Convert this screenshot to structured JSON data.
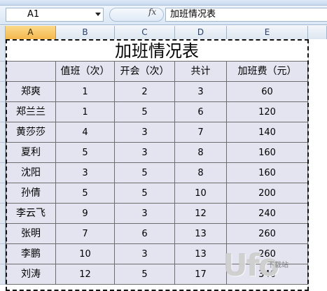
{
  "formula_bar": {
    "name_box": "A1",
    "fx_label": "fx",
    "formula_value": "加班情况表"
  },
  "columns": [
    {
      "label": "A",
      "selected": true
    },
    {
      "label": "B",
      "selected": false
    },
    {
      "label": "C",
      "selected": false
    },
    {
      "label": "D",
      "selected": false
    },
    {
      "label": "E",
      "selected": false
    }
  ],
  "sheet": {
    "title": "加班情况表",
    "headers": [
      "",
      "值班（次）",
      "开会（次）",
      "共计",
      "加班费（元）"
    ],
    "rows": [
      {
        "name": "郑爽",
        "duty": "1",
        "meeting": "2",
        "total": "3",
        "pay": "60"
      },
      {
        "name": "郑兰兰",
        "duty": "1",
        "meeting": "5",
        "total": "6",
        "pay": "120"
      },
      {
        "name": "黄莎莎",
        "duty": "4",
        "meeting": "3",
        "total": "7",
        "pay": "140"
      },
      {
        "name": "夏利",
        "duty": "5",
        "meeting": "3",
        "total": "8",
        "pay": "160"
      },
      {
        "name": "沈阳",
        "duty": "3",
        "meeting": "5",
        "total": "8",
        "pay": "160"
      },
      {
        "name": "孙倩",
        "duty": "5",
        "meeting": "5",
        "total": "10",
        "pay": "200"
      },
      {
        "name": "李云飞",
        "duty": "9",
        "meeting": "3",
        "total": "12",
        "pay": "240"
      },
      {
        "name": "张明",
        "duty": "7",
        "meeting": "6",
        "total": "13",
        "pay": "260"
      },
      {
        "name": "李鹏",
        "duty": "10",
        "meeting": "3",
        "total": "13",
        "pay": "260"
      },
      {
        "name": "刘涛",
        "duty": "12",
        "meeting": "5",
        "total": "17",
        "pay": "340"
      }
    ]
  },
  "watermark": {
    "logo_text": "Ufo",
    "sub_text": "下载站"
  }
}
